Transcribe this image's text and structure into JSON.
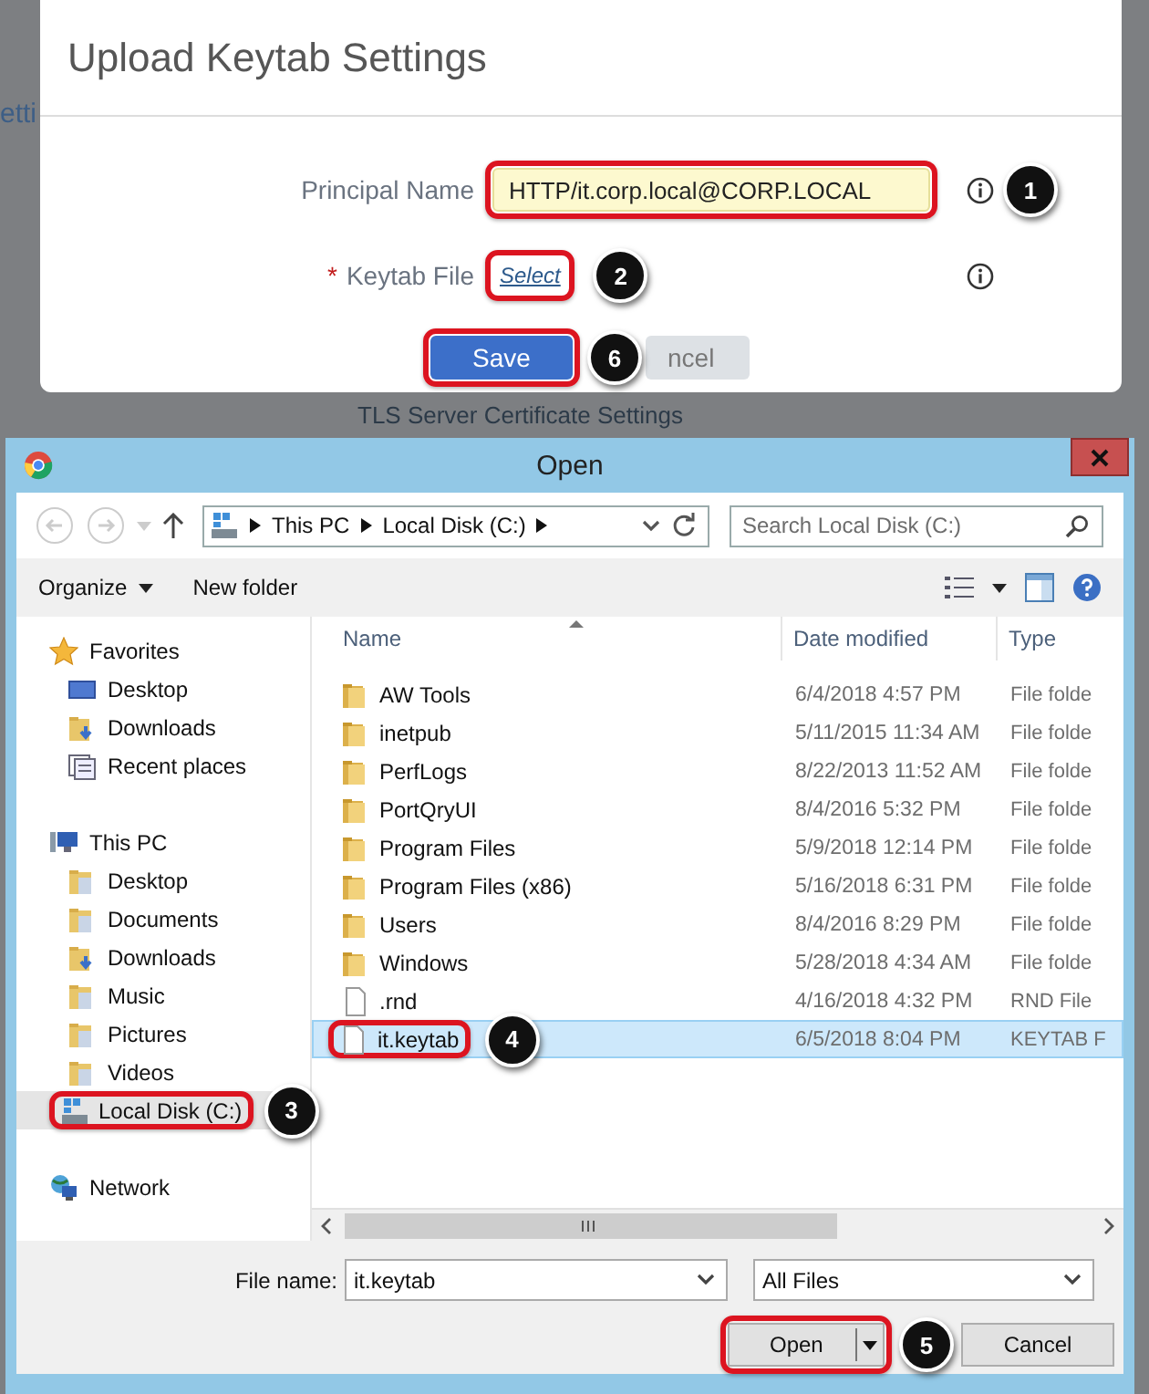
{
  "background": {
    "texts": [
      "etti",
      "TLS Server Certificate Settings"
    ]
  },
  "modal": {
    "title": "Upload Keytab Settings",
    "fields": [
      {
        "label": "Principal Name",
        "kind": "input",
        "value": "HTTP/it.corp.local@CORP.LOCAL",
        "info": true,
        "callout": "1"
      },
      {
        "label": "Keytab File",
        "required_mark": "*",
        "kind": "link",
        "value": "Select",
        "info": true,
        "callout": "2"
      }
    ],
    "buttons": [
      {
        "label": "Save",
        "kind": "primary",
        "callout": "6"
      },
      {
        "label": "ncel",
        "kind": "secondary"
      }
    ]
  },
  "dialog": {
    "title": "Open",
    "path": [
      "This PC",
      "Local Disk (C:)"
    ],
    "search": {
      "placeholder": "Search Local Disk (C:)"
    },
    "toolbar": {
      "organize": "Organize",
      "new_folder": "New folder"
    },
    "sidebar": [
      {
        "label": "Favorites",
        "kind": "star",
        "selected": false,
        "children": [
          {
            "label": "Desktop",
            "kind": "monitor",
            "selected": false
          },
          {
            "label": "Downloads",
            "kind": "download",
            "selected": false
          },
          {
            "label": "Recent places",
            "kind": "recent",
            "selected": false
          }
        ]
      },
      {
        "label": "This PC",
        "kind": "pc",
        "selected": false,
        "children": [
          {
            "label": "Desktop",
            "kind": "folder",
            "selected": false
          },
          {
            "label": "Documents",
            "kind": "folder",
            "selected": false
          },
          {
            "label": "Downloads",
            "kind": "download",
            "selected": false
          },
          {
            "label": "Music",
            "kind": "folder",
            "selected": false
          },
          {
            "label": "Pictures",
            "kind": "folder",
            "selected": false
          },
          {
            "label": "Videos",
            "kind": "folder",
            "selected": false
          },
          {
            "label": "Local Disk (C:)",
            "kind": "drive",
            "selected": true,
            "callout": "3"
          }
        ]
      },
      {
        "label": "Network",
        "kind": "network",
        "selected": false
      }
    ],
    "columns": [
      "Name",
      "Date modified",
      "Type"
    ],
    "files": [
      {
        "name": "AW Tools",
        "date": "6/4/2018 4:57 PM",
        "type": "File folde",
        "kind": "folder",
        "selected": false
      },
      {
        "name": "inetpub",
        "date": "5/11/2015 11:34 AM",
        "type": "File folde",
        "kind": "folder",
        "selected": false
      },
      {
        "name": "PerfLogs",
        "date": "8/22/2013 11:52 AM",
        "type": "File folde",
        "kind": "folder",
        "selected": false
      },
      {
        "name": "PortQryUI",
        "date": "8/4/2016 5:32 PM",
        "type": "File folde",
        "kind": "folder",
        "selected": false
      },
      {
        "name": "Program Files",
        "date": "5/9/2018 12:14 PM",
        "type": "File folde",
        "kind": "folder",
        "selected": false
      },
      {
        "name": "Program Files (x86)",
        "date": "5/16/2018 6:31 PM",
        "type": "File folde",
        "kind": "folder",
        "selected": false
      },
      {
        "name": "Users",
        "date": "8/4/2016 8:29 PM",
        "type": "File folde",
        "kind": "folder",
        "selected": false
      },
      {
        "name": "Windows",
        "date": "5/28/2018 4:34 AM",
        "type": "File folde",
        "kind": "folder",
        "selected": false
      },
      {
        "name": ".rnd",
        "date": "4/16/2018 4:32 PM",
        "type": "RND File",
        "kind": "file",
        "selected": false
      },
      {
        "name": "it.keytab",
        "date": "6/5/2018 8:04 PM",
        "type": "KEYTAB F",
        "kind": "file",
        "selected": true,
        "callout": "4"
      }
    ],
    "file_name": {
      "label": "File name:",
      "value": "it.keytab"
    },
    "file_type": "All Files",
    "buttons": [
      {
        "label": "Open",
        "kind": "split",
        "callout": "5"
      },
      {
        "label": "Cancel",
        "kind": "plain"
      }
    ]
  }
}
